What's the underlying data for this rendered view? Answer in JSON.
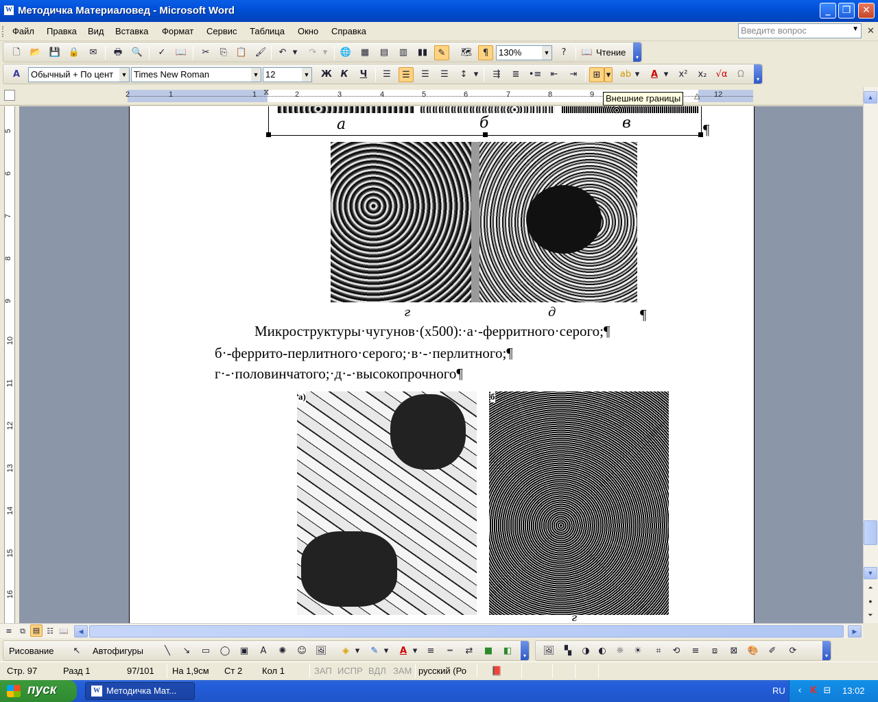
{
  "window": {
    "title": "Методичка Материаловед - Microsoft Word",
    "app_icon": "word-icon"
  },
  "menu": {
    "items": [
      "Файл",
      "Правка",
      "Вид",
      "Вставка",
      "Формат",
      "Сервис",
      "Таблица",
      "Окно",
      "Справка"
    ],
    "help_placeholder": "Введите вопрос"
  },
  "standard_toolbar": {
    "zoom": "130%",
    "reading_label": "Чтение"
  },
  "formatting_toolbar": {
    "style": "Обычный + По цент",
    "font": "Times New Roman",
    "size": "12",
    "bold": "Ж",
    "italic": "К",
    "underline": "Ч"
  },
  "ruler": {
    "numbers": [
      "2",
      "1",
      "1",
      "2",
      "3",
      "4",
      "5",
      "6",
      "7",
      "8",
      "9",
      "12"
    ]
  },
  "tooltip": "Внешние границы",
  "vertical_ruler": {
    "numbers": [
      "5",
      "6",
      "7",
      "8",
      "9",
      "10",
      "11",
      "12",
      "13",
      "14",
      "15",
      "16"
    ]
  },
  "document": {
    "caption_letters_top": [
      "а",
      "б",
      "в"
    ],
    "caption_letters_mid": [
      "г",
      "д"
    ],
    "paragraph_lines": [
      "Микроструктуры·чугунов·(х500):·а·-ферритного·серого;¶",
      "б·-феррито-перлитного·серого;·в·-·перлитного;¶",
      "г·-·половинчатого;·д·-·высокопрочного¶"
    ],
    "photo_labels": [
      "а)",
      "б"
    ],
    "pilcrow": "¶",
    "bottom_caption": "г"
  },
  "drawing_toolbar": {
    "drawing_label": "Рисование",
    "autoshapes_label": "Автофигуры"
  },
  "status": {
    "page": "Стр. 97",
    "section": "Разд 1",
    "pages": "97/101",
    "position": "На 1,9см",
    "line": "Ст 2",
    "column": "Кол 1",
    "rec": "ЗАП",
    "trk": "ИСПР",
    "ext": "ВДЛ",
    "ovr": "ЗАМ",
    "language": "русский (Ро"
  },
  "taskbar": {
    "start_label": "пуск",
    "task_label": "Методичка Мат...",
    "lang": "RU",
    "clock": "13:02"
  },
  "colors": {
    "titlebar": "#0050D8",
    "workspace": "#8C96A9",
    "taskbar": "#245EDC",
    "start": "#2F8A2F"
  }
}
